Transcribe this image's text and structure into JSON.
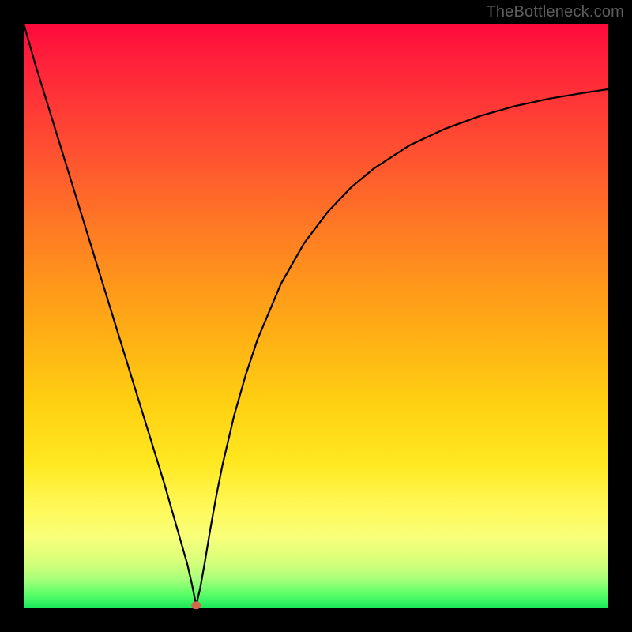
{
  "watermark": "TheBottleneck.com",
  "colors": {
    "frame": "#000000",
    "curve": "#000000",
    "marker": "#d16a4a",
    "gradient_top": "#ff0a3c",
    "gradient_bottom": "#17e85a"
  },
  "chart_data": {
    "type": "line",
    "title": "",
    "xlabel": "",
    "ylabel": "",
    "xlim": [
      0,
      100
    ],
    "ylim": [
      0,
      100
    ],
    "grid": false,
    "legend": false,
    "notes": "V-shaped bottleneck curve on rainbow heat gradient; minimum near x≈29. No axis ticks or numeric labels rendered.",
    "marker": {
      "x": 29.5,
      "y": 0.5
    },
    "series": [
      {
        "name": "bottleneck-curve",
        "x": [
          0,
          2,
          4,
          6,
          8,
          10,
          12,
          14,
          16,
          18,
          20,
          22,
          24,
          26,
          27,
          28,
          28.8,
          29.5,
          30.2,
          31,
          32,
          33,
          34,
          36,
          38,
          40,
          44,
          48,
          52,
          56,
          60,
          66,
          72,
          78,
          84,
          90,
          96,
          100
        ],
        "y": [
          100,
          93,
          86.5,
          80,
          73.5,
          67,
          60.5,
          54,
          47.5,
          41,
          34.5,
          28,
          21.5,
          14.5,
          11,
          7.5,
          4,
          0.5,
          3.5,
          8,
          14,
          19.5,
          24.5,
          33,
          40,
          46,
          55.5,
          62.5,
          67.8,
          72,
          75.3,
          79.2,
          82,
          84.2,
          85.9,
          87.2,
          88.2,
          88.8
        ]
      }
    ]
  }
}
